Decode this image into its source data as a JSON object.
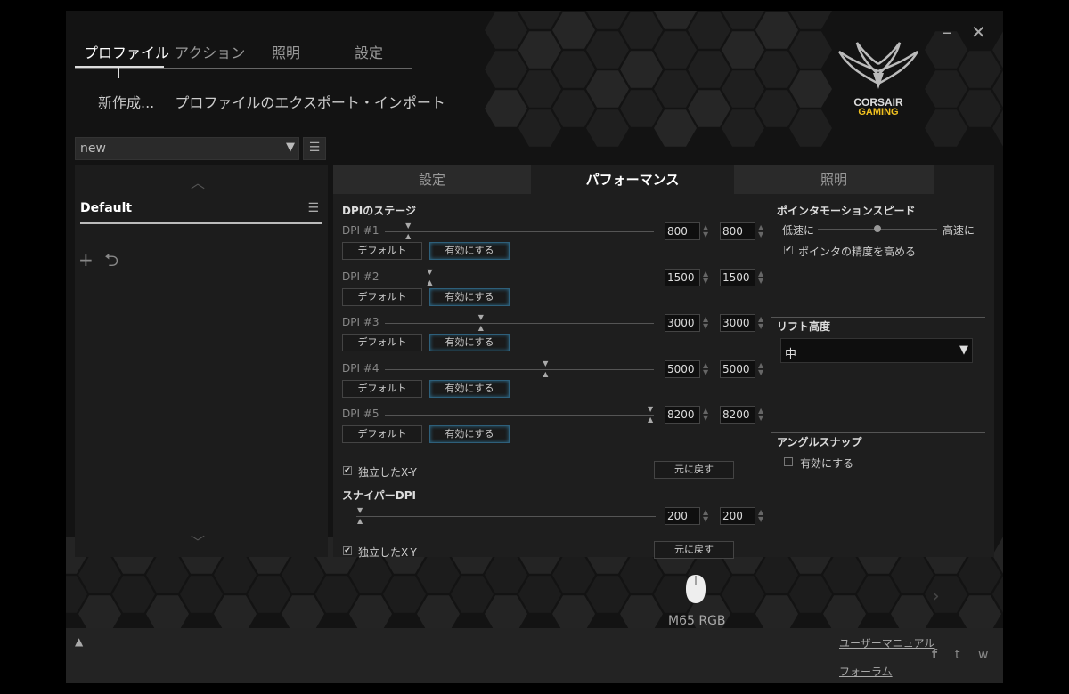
{
  "nav": {
    "tabs": [
      "プロファイル",
      "アクション",
      "照明",
      "設定"
    ],
    "active": 0
  },
  "window_controls": {
    "minimize": "–",
    "close": "✕"
  },
  "brand": {
    "line1": "CORSAIR",
    "line2": "GAMING",
    "accent_color": "#f0c020"
  },
  "subactions": {
    "new": "新作成...",
    "export_import": "プロファイルのエクスポート・インポート"
  },
  "profile_select": {
    "value": "new",
    "arrow": "▼",
    "menu": "☰"
  },
  "profiles": {
    "item": "Default",
    "menu": "☰",
    "add_icon": "+",
    "import_icon": "⮌"
  },
  "right_tabs": [
    "設定",
    "パフォーマンス",
    "照明"
  ],
  "dpi": {
    "section_title": "DPIのステージ",
    "stages": [
      {
        "label": "DPI #1",
        "x": "800",
        "y": "800",
        "default_btn": "デフォルト",
        "enable_btn": "有効にする",
        "level": 0.09
      },
      {
        "label": "DPI #2",
        "x": "1500",
        "y": "1500",
        "default_btn": "デフォルト",
        "enable_btn": "有効にする",
        "level": 0.17
      },
      {
        "label": "DPI #3",
        "x": "3000",
        "y": "3000",
        "default_btn": "デフォルト",
        "enable_btn": "有効にする",
        "level": 0.36
      },
      {
        "label": "DPI #4",
        "x": "5000",
        "y": "5000",
        "default_btn": "デフォルト",
        "enable_btn": "有効にする",
        "level": 0.6
      },
      {
        "label": "DPI #5",
        "x": "8200",
        "y": "8200",
        "default_btn": "デフォルト",
        "enable_btn": "有効にする",
        "level": 0.99
      }
    ],
    "independent_xy": "独立したX-Y",
    "reset": "元に戻す"
  },
  "sniper": {
    "title": "スナイパーDPI",
    "x": "200",
    "y": "200",
    "level": 0.0,
    "independent_xy": "独立したX-Y",
    "reset": "元に戻す"
  },
  "pointer_speed": {
    "title": "ポインタモーションスピード",
    "slow": "低速に",
    "fast": "高速に",
    "level": 0.5,
    "precision": "ポインタの精度を高める"
  },
  "lift_height": {
    "title": "リフト高度",
    "value": "中",
    "arrow": "▼"
  },
  "angle_snap": {
    "title": "アングルスナップ",
    "enable": "有効にする"
  },
  "checks": {
    "on": "✔",
    "off": ""
  },
  "spin_arrows": "▲▼",
  "device": {
    "name": "M65 RGB",
    "prev": "‹",
    "next": "›"
  },
  "footer": {
    "manual": "ユーザーマニュアル",
    "forum": "フォーラム",
    "up_arrow": "▲",
    "social": [
      "f",
      "t",
      "w"
    ]
  }
}
